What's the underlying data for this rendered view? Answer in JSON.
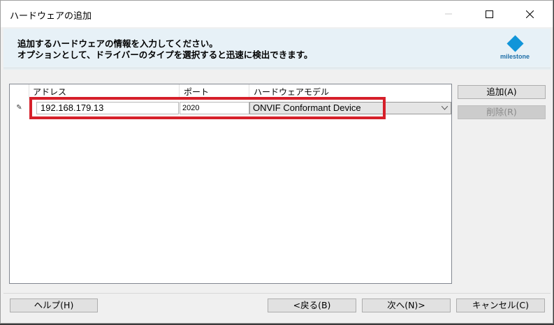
{
  "window": {
    "title": "ハードウェアの追加",
    "controls": {
      "minimize": "—",
      "maximize": "☐",
      "close": "✕"
    }
  },
  "header": {
    "line1": "追加するハードウェアの情報を入力してください。",
    "line2": "オプションとして、ドライバーのタイプを選択すると迅速に検出できます。",
    "logo_text": "milestone",
    "logo_color": "#1195d9"
  },
  "grid": {
    "columns": [
      "アドレス",
      "ポート",
      "ハードウェアモデル"
    ],
    "row": {
      "marker": "✎",
      "address": "192.168.179.13",
      "port": "2020",
      "model": "ONVIF Conformant Device"
    }
  },
  "side_buttons": {
    "add": "追加(A)",
    "remove": "削除(R)"
  },
  "footer_buttons": {
    "help": "ヘルプ(H)",
    "back": "<戻る(B)",
    "next": "次へ(N)>",
    "cancel": "キャンセル(C)"
  },
  "colors": {
    "highlight": "#d6202a",
    "header_bg": "#e7f1f7"
  }
}
